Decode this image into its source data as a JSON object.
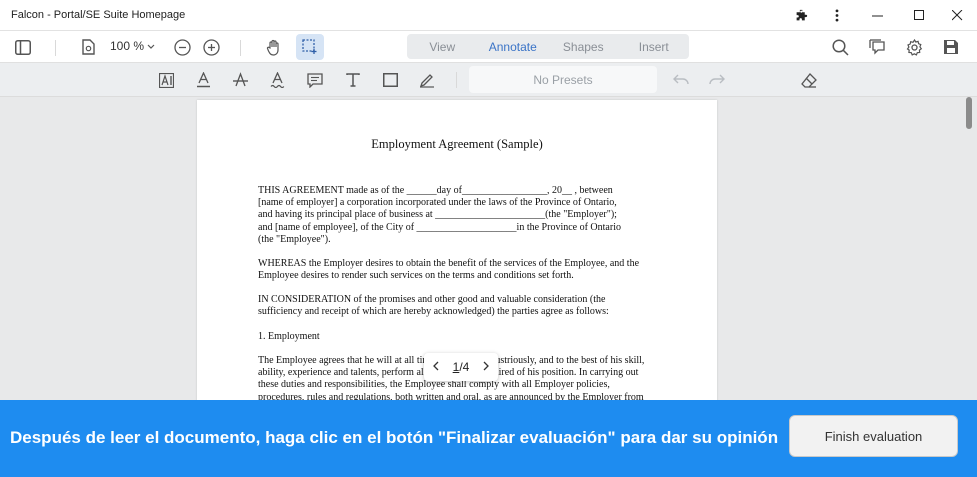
{
  "window": {
    "title": "Falcon - Portal/SE Suite Homepage"
  },
  "toolbar": {
    "zoom_level": "100 %",
    "tabs": [
      {
        "label": "View",
        "active": false
      },
      {
        "label": "Annotate",
        "active": true
      },
      {
        "label": "Shapes",
        "active": false
      },
      {
        "label": "Insert",
        "active": false
      }
    ]
  },
  "annotate_toolbar": {
    "presets_label": "No Presets"
  },
  "document": {
    "title": "Employment Agreement (Sample)",
    "paragraphs": [
      [
        "THIS AGREEMENT made as of the ______day of_________________, 20__ , between",
        "[name of employer] a corporation incorporated under the laws of the Province of Ontario,",
        "and having its principal place of business at ______________________(the \"Employer\");",
        "and [name of employee], of the City of ____________________in the Province of Ontario",
        "(the \"Employee\")."
      ],
      [
        "WHEREAS the Employer desires to obtain the benefit of the services of the Employee, and the",
        "Employee desires to render such services on the terms and conditions set forth."
      ],
      [
        "IN CONSIDERATION of the promises and other good and valuable consideration (the",
        "sufficiency and receipt of which are hereby acknowledged) the parties agree as follows:"
      ],
      [
        "1. Employment"
      ],
      [
        "The Employee agrees that he will at all times faithfully, industriously, and to the best of his skill,",
        "ability, experience and talents, perform all of the duties required of his position. In carrying out",
        "these duties and responsibilities, the Employee shall comply with all Employer policies,",
        "procedures, rules and regulations, both written and oral, as are announced by the Employer from"
      ]
    ]
  },
  "pager": {
    "current": "1",
    "separator": "/",
    "total": "4"
  },
  "banner": {
    "message": "Después de leer el documento, haga clic en el botón \"Finalizar evaluación\" para dar su opinión",
    "button_label": "Finish evaluation",
    "color": "#1e8cf0"
  },
  "colors": {
    "accent": "#3b74c7",
    "selected_tool_bg": "#d6e4f5"
  }
}
